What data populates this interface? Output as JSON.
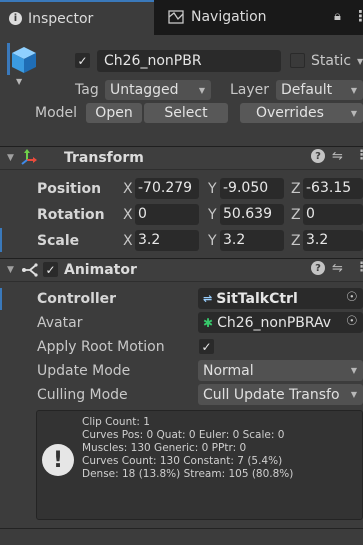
{
  "tabs": [
    {
      "label": "Inspector",
      "icon": "info-icon",
      "active": true
    },
    {
      "label": "Navigation",
      "icon": "navigation-icon",
      "active": false
    }
  ],
  "header": {
    "name": "Ch26_nonPBR",
    "active_checked": true,
    "static_label": "Static",
    "tag_label": "Tag",
    "tag_value": "Untagged",
    "layer_label": "Layer",
    "layer_value": "Default",
    "model_label": "Model",
    "open_label": "Open",
    "select_label": "Select",
    "overrides_label": "Overrides"
  },
  "transform": {
    "title": "Transform",
    "rows": [
      {
        "label": "Position",
        "x": "-70.279",
        "y": "-9.050",
        "z": "-63.15"
      },
      {
        "label": "Rotation",
        "x": "0",
        "y": "50.639",
        "z": "0"
      },
      {
        "label": "Scale",
        "x": "3.2",
        "y": "3.2",
        "z": "3.2"
      }
    ],
    "axes": [
      "X",
      "Y",
      "Z"
    ]
  },
  "animator": {
    "title": "Animator",
    "enabled": true,
    "controller_label": "Controller",
    "controller_value": "SitTalkCtrl",
    "avatar_label": "Avatar",
    "avatar_value": "Ch26_nonPBRAv",
    "apply_root_motion_label": "Apply Root Motion",
    "apply_root_motion_checked": true,
    "update_mode_label": "Update Mode",
    "update_mode_value": "Normal",
    "culling_mode_label": "Culling Mode",
    "culling_mode_value": "Cull Update Transfo",
    "info_lines": [
      "Clip Count: 1",
      "Curves Pos: 0 Quat: 0 Euler: 0 Scale: 0",
      "Muscles: 130 Generic: 0 PPtr: 0",
      "Curves Count: 130 Constant: 7 (5.4%)",
      "Dense: 18 (13.8%) Stream: 105 (80.8%)"
    ]
  },
  "colors": {
    "accent": "#3a79bb",
    "panel_bg": "#3c3c3c",
    "field_bg": "#2a2a2a"
  }
}
